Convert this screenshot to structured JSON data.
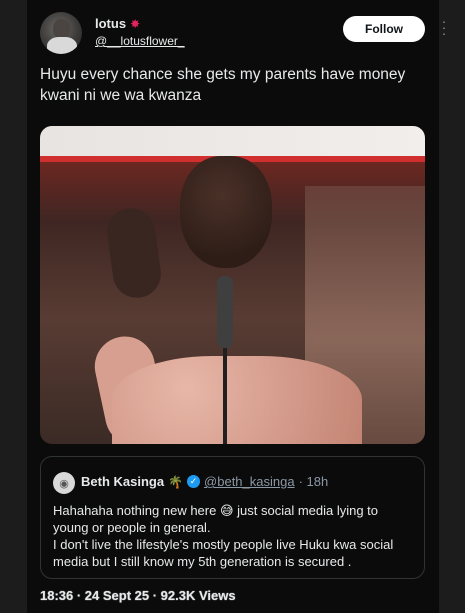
{
  "author": {
    "display_name": "lotus",
    "flower_icon": "flower-icon",
    "handle": "@__lotusflower_"
  },
  "follow_label": "Follow",
  "tweet": {
    "text": "Huyu every chance she  gets my parents have money kwani ni we wa kwanza"
  },
  "media": {
    "type": "video-thumbnail",
    "description_icon": "image-icon"
  },
  "quote": {
    "author_name": "Beth Kasinga",
    "emoji_icon": "palm-tree-icon",
    "verified": true,
    "handle": "@beth_kasinga",
    "time": "· 18h",
    "lines": [
      "Hahahaha nothing new here 😅 just social media lying to",
      "young or people in general.",
      "I don't live the lifestyle's mostly people live Huku kwa social",
      "media but I still know my 5th generation is secured ."
    ]
  },
  "meta": {
    "time": "18:36 · 24 Sept 25 · 92.3K Views"
  },
  "colors": {
    "background": "#000000",
    "text": "#e7e9ea",
    "muted": "#8b98a5",
    "verified": "#1d9bf0",
    "border": "#2f3336"
  }
}
